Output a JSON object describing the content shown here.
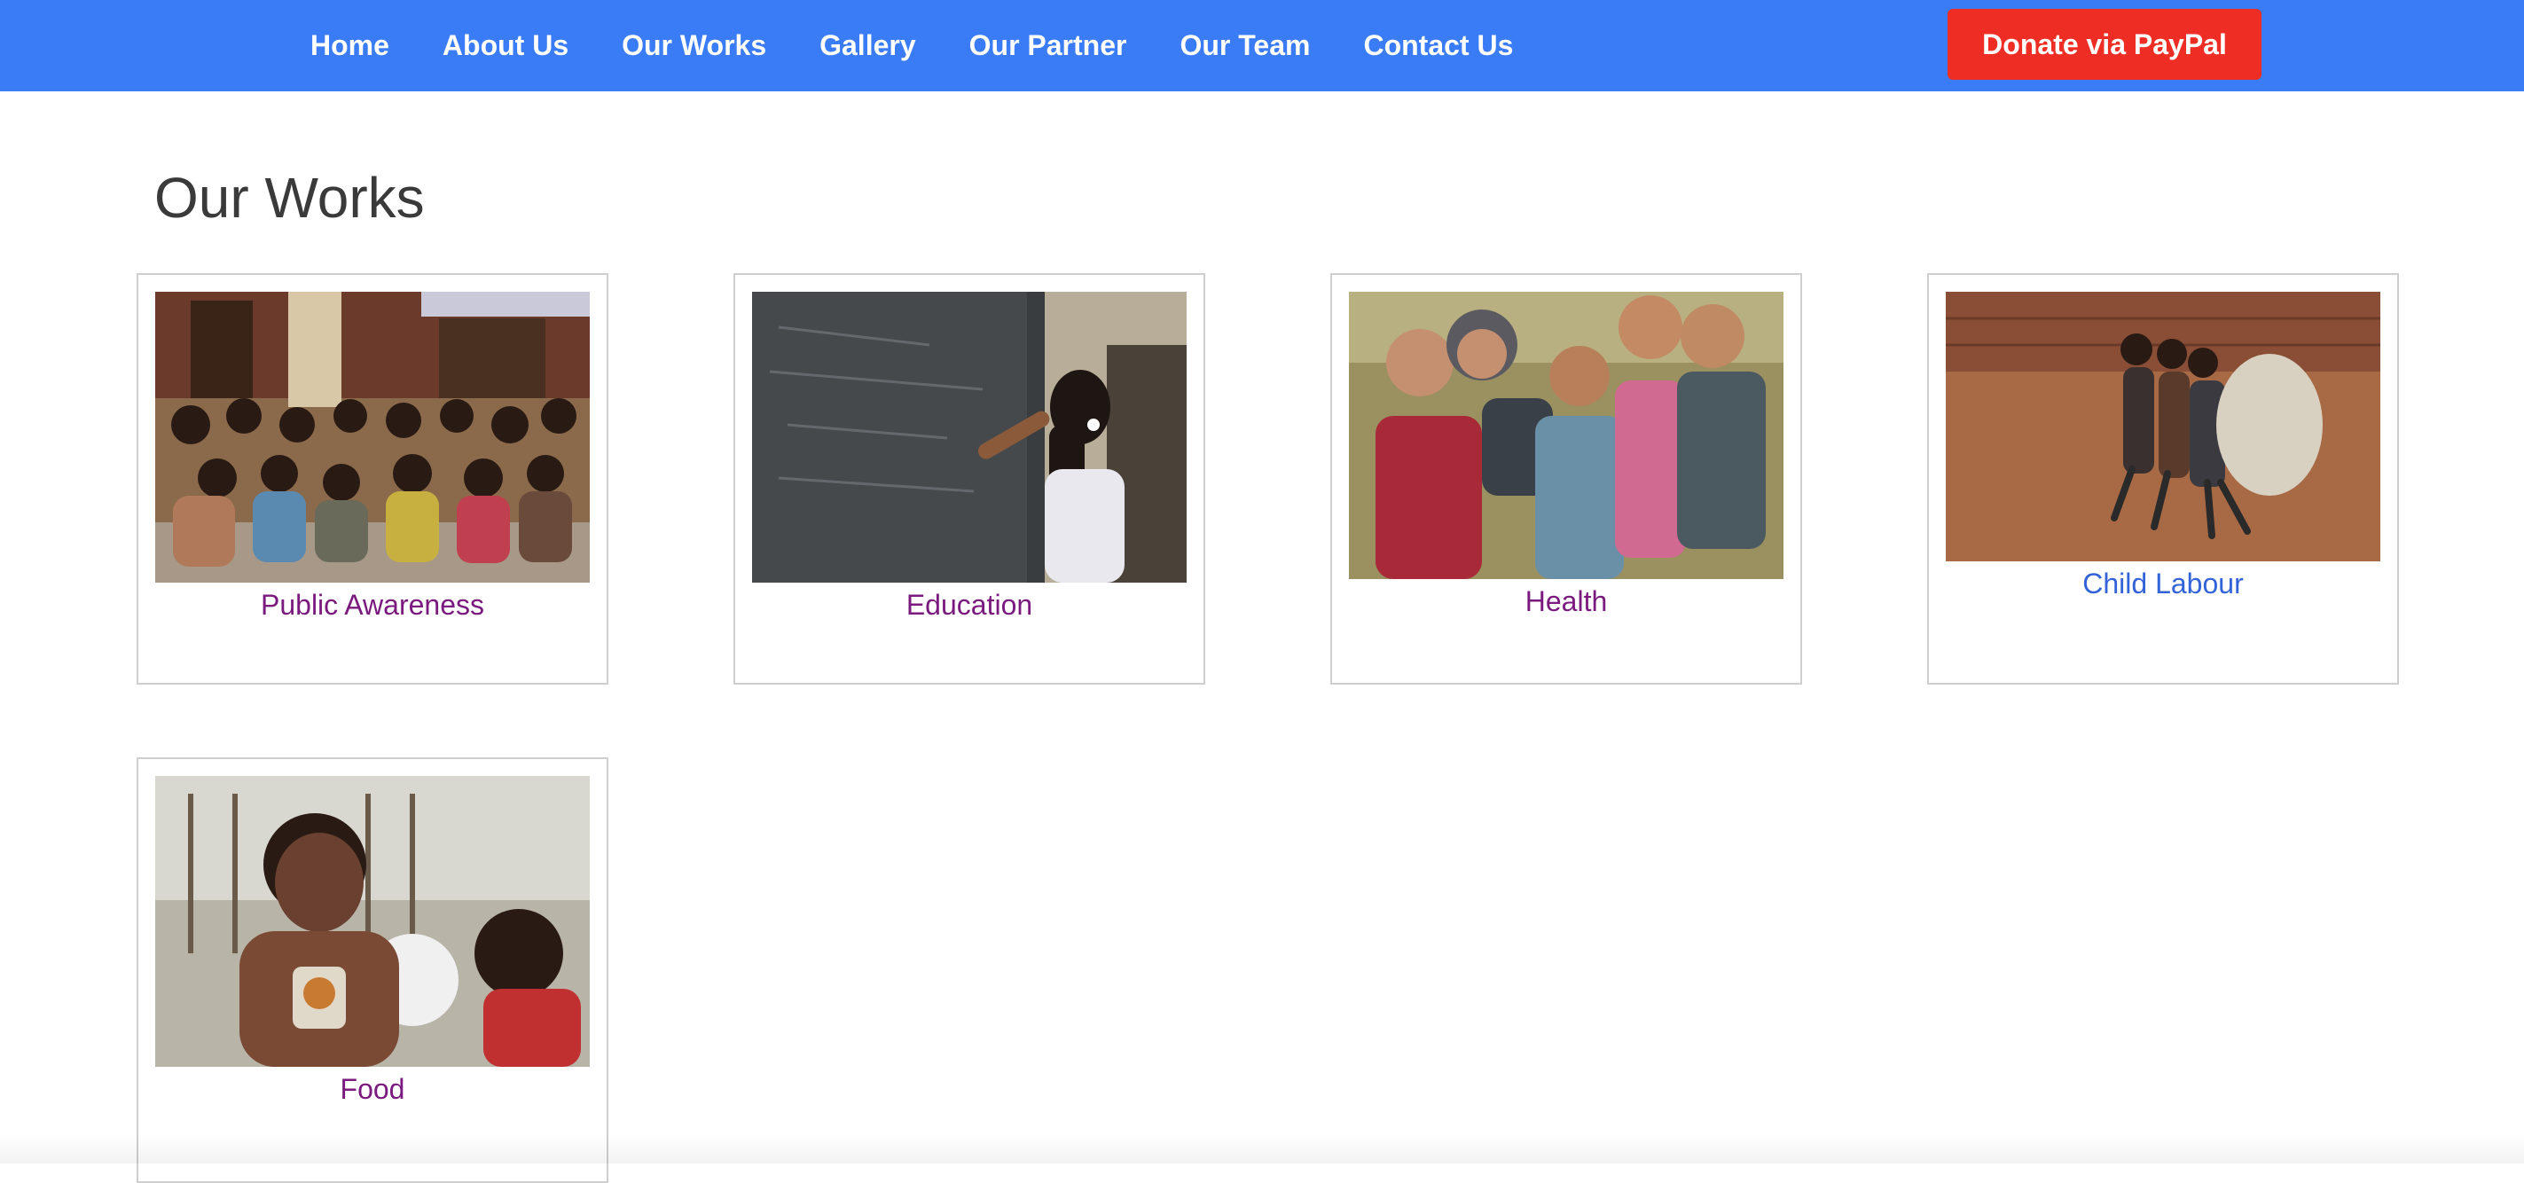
{
  "nav": {
    "items": [
      {
        "id": "home",
        "label": "Home"
      },
      {
        "id": "about-us",
        "label": "About Us"
      },
      {
        "id": "our-works",
        "label": "Our Works"
      },
      {
        "id": "gallery",
        "label": "Gallery"
      },
      {
        "id": "our-partner",
        "label": "Our Partner"
      },
      {
        "id": "our-team",
        "label": "Our Team"
      },
      {
        "id": "contact-us",
        "label": "Contact Us"
      }
    ],
    "donate_label": "Donate via PayPal",
    "background_color": "#3a7cf5",
    "donate_color": "#ee2e24"
  },
  "main": {
    "title": "Our Works",
    "cards": [
      {
        "label": "Public Awareness",
        "image": "children-seated-photo"
      },
      {
        "label": "Education",
        "image": "girl-writing-on-chalkboard-photo"
      },
      {
        "label": "Health",
        "image": "smiling-children-group-photo"
      },
      {
        "label": "Child Labour",
        "image": "boys-carrying-sack-photo"
      },
      {
        "label": "Food",
        "image": "smiling-child-with-snack-photo"
      }
    ],
    "visited_link_color": "#7a1a7e",
    "hover_link_color": "#3363d8"
  }
}
